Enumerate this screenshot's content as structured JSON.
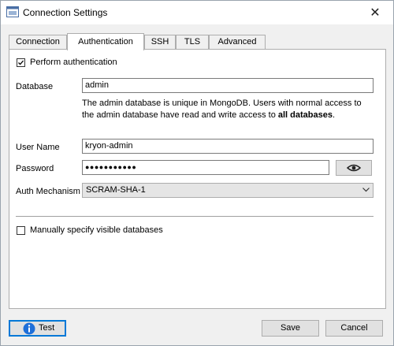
{
  "window": {
    "title": "Connection Settings",
    "close_glyph": "✕"
  },
  "tabs": [
    {
      "label": "Connection",
      "active": false
    },
    {
      "label": "Authentication",
      "active": true
    },
    {
      "label": "SSH",
      "active": false
    },
    {
      "label": "TLS",
      "active": false
    },
    {
      "label": "Advanced",
      "active": false
    }
  ],
  "auth": {
    "perform_label": "Perform authentication",
    "perform_checked": true,
    "database_label": "Database",
    "database_value": "admin",
    "info_text_before": "The admin database is unique in MongoDB. Users with normal access to the admin database have read and write access to ",
    "info_text_bold": "all databases",
    "info_text_after": ".",
    "username_label": "User Name",
    "username_value": "kryon-admin",
    "password_label": "Password",
    "password_value": "●●●●●●●●●●●",
    "mechanism_label": "Auth Mechanism",
    "mechanism_value": "SCRAM-SHA-1",
    "manual_label": "Manually specify visible databases",
    "manual_checked": false
  },
  "footer": {
    "test_label": "Test",
    "save_label": "Save",
    "cancel_label": "Cancel"
  },
  "icons": {
    "app": "window-icon",
    "close": "close-icon",
    "eye": "eye-icon",
    "info": "info-icon",
    "dropdown": "chevron-down-icon"
  },
  "colors": {
    "accent": "#0078d7",
    "info_icon": "#1e6fd9"
  }
}
